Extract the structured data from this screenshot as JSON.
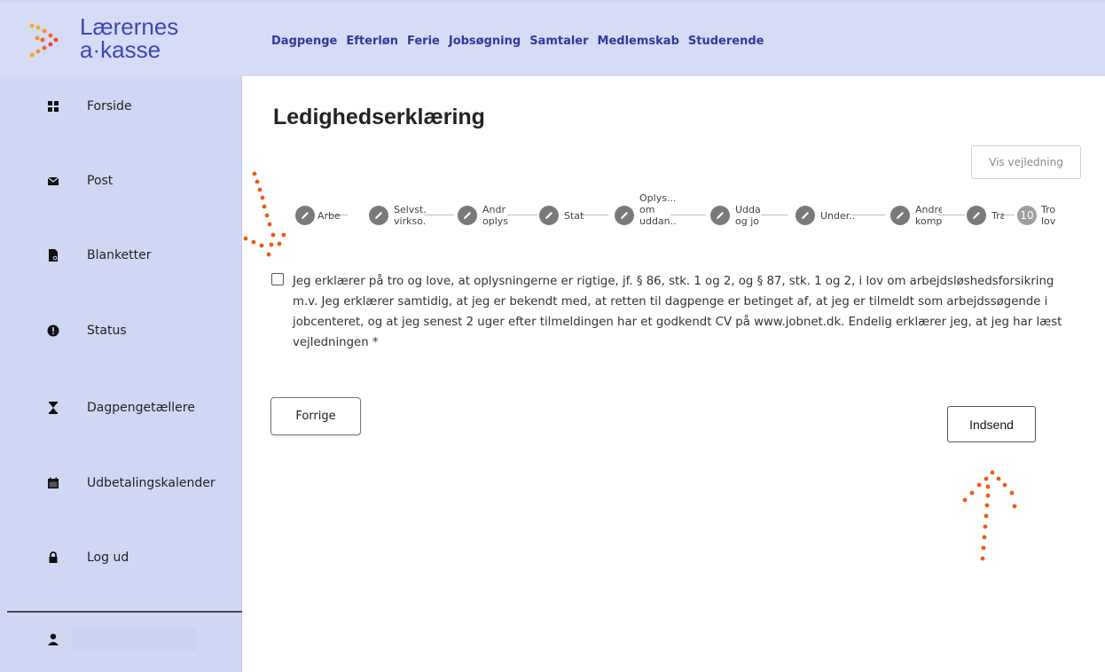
{
  "header": {
    "logo_line1": "Lærernes",
    "logo_line2": "a·kasse",
    "nav": [
      "Dagpenge",
      "Efterløn",
      "Ferie",
      "Jobsøgning",
      "Samtaler",
      "Medlemskab",
      "Studerende"
    ]
  },
  "sidebar": {
    "items": [
      {
        "label": "Forside",
        "icon": "grid-icon"
      },
      {
        "label": "Post",
        "icon": "envelope-icon"
      },
      {
        "label": "Blanketter",
        "icon": "form-search-icon"
      },
      {
        "label": "Status",
        "icon": "exclamation-circle-icon"
      },
      {
        "label": "Dagpengetællere",
        "icon": "hourglass-icon"
      },
      {
        "label": "Udbetalingskalender",
        "icon": "calendar-icon"
      },
      {
        "label": "Log ud",
        "icon": "lock-icon"
      }
    ],
    "user_icon": "user-icon"
  },
  "main": {
    "title": "Ledighedserklæring",
    "guide_button": "Vis vejledning",
    "steps": [
      {
        "label": "Arbe",
        "icon": "pencil-icon"
      },
      {
        "label": "Selvst.\nvirkso.",
        "icon": "pencil-icon"
      },
      {
        "label": "Andr\noplys",
        "icon": "pencil-icon"
      },
      {
        "label": "Stat:",
        "icon": "pencil-icon"
      },
      {
        "label": "Oplys...\nom\nuddan..",
        "icon": "pencil-icon"
      },
      {
        "label": "Udda\nog jo",
        "icon": "pencil-icon"
      },
      {
        "label": "Under..",
        "icon": "pencil-icon"
      },
      {
        "label": "Andre\nkomp",
        "icon": "pencil-icon"
      },
      {
        "label": "Tra",
        "icon": "pencil-icon"
      },
      {
        "label": "Tro\nlov",
        "number": "10"
      }
    ],
    "consent_text": "Jeg erklærer på tro og love, at oplysningerne er rigtige, jf. § 86, stk. 1 og 2, og § 87, stk. 1 og 2, i lov om arbejdsløshedsforsikring m.v. Jeg erklærer samtidig, at jeg er bekendt med, at retten til dagpenge er betinget af, at jeg er tilmeldt som arbejdssøgende i jobcenteret, og at jeg senest 2 uger efter tilmeldingen har et godkendt CV på www.jobnet.dk. Endelig erklærer jeg, at jeg har læst vejledningen *",
    "consent_checked": false,
    "prev_button": "Forrige",
    "send_button": "Indsend"
  },
  "colors": {
    "header_bg": "#d6dcf6",
    "sidebar_bg": "#d0d7f4",
    "brand_blue": "#3d47b3",
    "nav_blue": "#2f3a9a",
    "annotation_orange": "#f05a13",
    "step_gray": "#7a7a7a"
  }
}
